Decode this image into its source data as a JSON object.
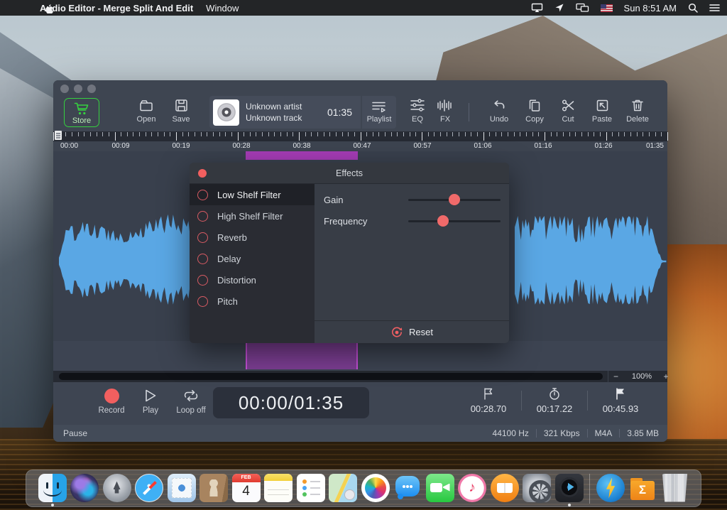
{
  "menu_bar": {
    "app_name": "Audio Editor - Merge Split And Edit",
    "menu_window": "Window",
    "clock": "Sun 8:51 AM",
    "icons": [
      "apple-logo",
      "airplay-display",
      "location-arrow",
      "displays",
      "us-flag",
      "spotlight-search",
      "notification-list"
    ]
  },
  "toolbar": {
    "store_label": "Store",
    "open_label": "Open",
    "save_label": "Save",
    "artist": "Unknown artist",
    "track": "Unknown track",
    "duration": "01:35",
    "playlist_label": "Playlist",
    "eq_label": "EQ",
    "fx_label": "FX",
    "undo_label": "Undo",
    "copy_label": "Copy",
    "cut_label": "Cut",
    "paste_label": "Paste",
    "delete_label": "Delete"
  },
  "ruler": {
    "labels": [
      "00:00",
      "00:09",
      "00:19",
      "00:28",
      "00:38",
      "00:47",
      "00:57",
      "01:06",
      "01:16",
      "01:26",
      "01:35"
    ]
  },
  "effects": {
    "title": "Effects",
    "filters": [
      "Low Shelf Filter",
      "High Shelf Filter",
      "Reverb",
      "Delay",
      "Distortion",
      "Pitch"
    ],
    "selected_index": 0,
    "sliders": [
      {
        "label": "Gain",
        "value_pct": 50
      },
      {
        "label": "Frequency",
        "value_pct": 38
      }
    ],
    "reset_label": "Reset"
  },
  "zoom_control": {
    "minus": "−",
    "level": "100%",
    "plus": "+"
  },
  "transport": {
    "record_label": "Record",
    "play_label": "Play",
    "loop_label": "Loop off",
    "time_display": "00:00/01:35",
    "selection_start": "00:28.70",
    "selection_duration": "00:17.22",
    "selection_end": "00:45.93"
  },
  "status_bar": {
    "state": "Pause",
    "sample_rate": "44100 Hz",
    "bitrate": "321 Kbps",
    "format": "M4A",
    "file_size": "3.85 MB"
  },
  "dock": {
    "items": [
      "finder",
      "siri",
      "launchpad",
      "safari",
      "mail",
      "contacts",
      "calendar",
      "notes",
      "reminders",
      "maps",
      "photos",
      "messages",
      "facetime",
      "itunes",
      "ibooks",
      "system-preferences",
      "audio-editor",
      "app-downloader",
      "sigma-folder",
      "trash"
    ],
    "calendar_month": "FEB",
    "calendar_day": "4",
    "sigma": "Σ"
  },
  "colors": {
    "accent_green": "#35d13f",
    "accent_red": "#ef5e63",
    "selection_purple": "#a53cb5",
    "waveform_blue": "#5aa7e4"
  }
}
